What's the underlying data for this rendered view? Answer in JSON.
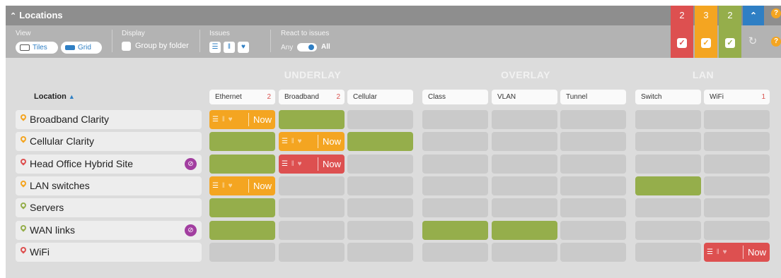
{
  "header": {
    "title": "Locations",
    "collapse_icon": "double-chevron-up-icon",
    "counters": [
      {
        "value": "2",
        "color": "#dd5050"
      },
      {
        "value": "3",
        "color": "#f4a521"
      },
      {
        "value": "2",
        "color": "#95ae4b"
      }
    ],
    "collapse_button_icon": "chevron-up-icon",
    "help_icon": "help-icon"
  },
  "toolbar": {
    "view_label": "View",
    "tiles_label": "Tiles",
    "grid_label": "Grid",
    "display_label": "Display",
    "group_by_folder_label": "Group by folder",
    "issues_label": "Issues",
    "react_label": "React to issues",
    "react_any_label": "Any",
    "react_all_label": "All"
  },
  "grid": {
    "groups": [
      "UNDERLAY",
      "OVERLAY",
      "LAN"
    ],
    "location_header": "Location",
    "sort_arrow": "▲",
    "columns": [
      {
        "label": "Ethernet",
        "count": "2"
      },
      {
        "label": "Broadband",
        "count": "2"
      },
      {
        "label": "Cellular",
        "count": ""
      },
      {
        "label": "Class",
        "count": ""
      },
      {
        "label": "VLAN",
        "count": ""
      },
      {
        "label": "Tunnel",
        "count": ""
      },
      {
        "label": "Switch",
        "count": ""
      },
      {
        "label": "WiFi",
        "count": "1"
      }
    ],
    "now_label": "Now",
    "rows": [
      {
        "name": "Broadband Clarity",
        "pin_color": "#f4a521",
        "badge": false,
        "cells": [
          "orange",
          "green",
          "grey",
          "grey",
          "grey",
          "grey",
          "grey",
          "grey"
        ]
      },
      {
        "name": "Cellular Clarity",
        "pin_color": "#f4a521",
        "badge": false,
        "cells": [
          "green",
          "orange",
          "green",
          "grey",
          "grey",
          "grey",
          "grey",
          "grey"
        ]
      },
      {
        "name": "Head Office Hybrid Site",
        "pin_color": "#dd5050",
        "badge": true,
        "cells": [
          "green",
          "red",
          "grey",
          "grey",
          "grey",
          "grey",
          "grey",
          "grey"
        ]
      },
      {
        "name": "LAN switches",
        "pin_color": "#f4a521",
        "badge": false,
        "cells": [
          "orange",
          "grey",
          "grey",
          "grey",
          "grey",
          "grey",
          "green",
          "grey"
        ]
      },
      {
        "name": "Servers",
        "pin_color": "#95ae4b",
        "badge": false,
        "cells": [
          "green",
          "grey",
          "grey",
          "grey",
          "grey",
          "grey",
          "grey",
          "grey"
        ]
      },
      {
        "name": "WAN links",
        "pin_color": "#95ae4b",
        "badge": true,
        "cells": [
          "green",
          "grey",
          "grey",
          "green",
          "green",
          "grey",
          "grey",
          "grey"
        ]
      },
      {
        "name": "WiFi",
        "pin_color": "#dd5050",
        "badge": false,
        "cells": [
          "grey",
          "grey",
          "grey",
          "grey",
          "grey",
          "grey",
          "grey",
          "red"
        ]
      }
    ]
  }
}
